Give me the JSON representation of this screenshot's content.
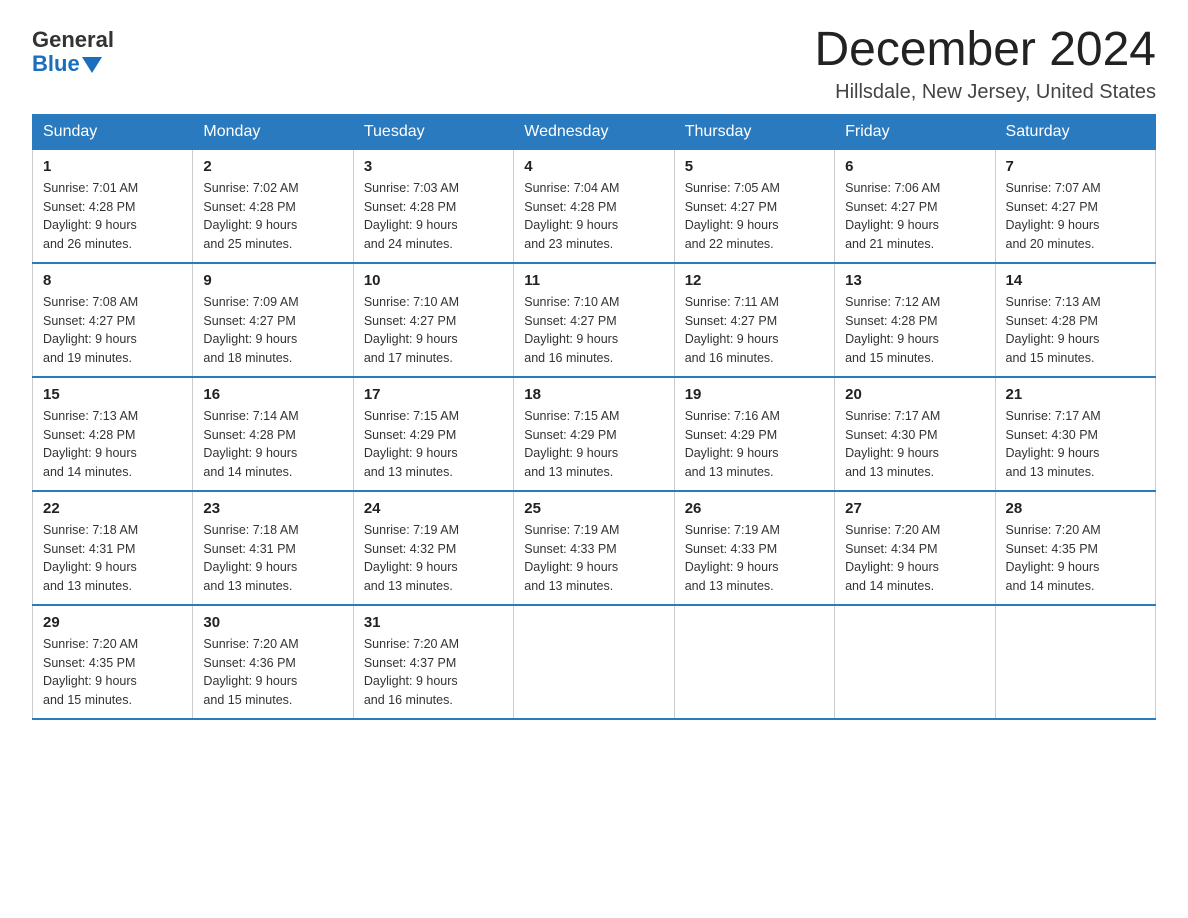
{
  "logo": {
    "general": "General",
    "blue": "Blue"
  },
  "header": {
    "month": "December 2024",
    "location": "Hillsdale, New Jersey, United States"
  },
  "weekdays": [
    "Sunday",
    "Monday",
    "Tuesday",
    "Wednesday",
    "Thursday",
    "Friday",
    "Saturday"
  ],
  "weeks": [
    [
      {
        "day": "1",
        "sunrise": "7:01 AM",
        "sunset": "4:28 PM",
        "daylight": "9 hours and 26 minutes."
      },
      {
        "day": "2",
        "sunrise": "7:02 AM",
        "sunset": "4:28 PM",
        "daylight": "9 hours and 25 minutes."
      },
      {
        "day": "3",
        "sunrise": "7:03 AM",
        "sunset": "4:28 PM",
        "daylight": "9 hours and 24 minutes."
      },
      {
        "day": "4",
        "sunrise": "7:04 AM",
        "sunset": "4:28 PM",
        "daylight": "9 hours and 23 minutes."
      },
      {
        "day": "5",
        "sunrise": "7:05 AM",
        "sunset": "4:27 PM",
        "daylight": "9 hours and 22 minutes."
      },
      {
        "day": "6",
        "sunrise": "7:06 AM",
        "sunset": "4:27 PM",
        "daylight": "9 hours and 21 minutes."
      },
      {
        "day": "7",
        "sunrise": "7:07 AM",
        "sunset": "4:27 PM",
        "daylight": "9 hours and 20 minutes."
      }
    ],
    [
      {
        "day": "8",
        "sunrise": "7:08 AM",
        "sunset": "4:27 PM",
        "daylight": "9 hours and 19 minutes."
      },
      {
        "day": "9",
        "sunrise": "7:09 AM",
        "sunset": "4:27 PM",
        "daylight": "9 hours and 18 minutes."
      },
      {
        "day": "10",
        "sunrise": "7:10 AM",
        "sunset": "4:27 PM",
        "daylight": "9 hours and 17 minutes."
      },
      {
        "day": "11",
        "sunrise": "7:10 AM",
        "sunset": "4:27 PM",
        "daylight": "9 hours and 16 minutes."
      },
      {
        "day": "12",
        "sunrise": "7:11 AM",
        "sunset": "4:27 PM",
        "daylight": "9 hours and 16 minutes."
      },
      {
        "day": "13",
        "sunrise": "7:12 AM",
        "sunset": "4:28 PM",
        "daylight": "9 hours and 15 minutes."
      },
      {
        "day": "14",
        "sunrise": "7:13 AM",
        "sunset": "4:28 PM",
        "daylight": "9 hours and 15 minutes."
      }
    ],
    [
      {
        "day": "15",
        "sunrise": "7:13 AM",
        "sunset": "4:28 PM",
        "daylight": "9 hours and 14 minutes."
      },
      {
        "day": "16",
        "sunrise": "7:14 AM",
        "sunset": "4:28 PM",
        "daylight": "9 hours and 14 minutes."
      },
      {
        "day": "17",
        "sunrise": "7:15 AM",
        "sunset": "4:29 PM",
        "daylight": "9 hours and 13 minutes."
      },
      {
        "day": "18",
        "sunrise": "7:15 AM",
        "sunset": "4:29 PM",
        "daylight": "9 hours and 13 minutes."
      },
      {
        "day": "19",
        "sunrise": "7:16 AM",
        "sunset": "4:29 PM",
        "daylight": "9 hours and 13 minutes."
      },
      {
        "day": "20",
        "sunrise": "7:17 AM",
        "sunset": "4:30 PM",
        "daylight": "9 hours and 13 minutes."
      },
      {
        "day": "21",
        "sunrise": "7:17 AM",
        "sunset": "4:30 PM",
        "daylight": "9 hours and 13 minutes."
      }
    ],
    [
      {
        "day": "22",
        "sunrise": "7:18 AM",
        "sunset": "4:31 PM",
        "daylight": "9 hours and 13 minutes."
      },
      {
        "day": "23",
        "sunrise": "7:18 AM",
        "sunset": "4:31 PM",
        "daylight": "9 hours and 13 minutes."
      },
      {
        "day": "24",
        "sunrise": "7:19 AM",
        "sunset": "4:32 PM",
        "daylight": "9 hours and 13 minutes."
      },
      {
        "day": "25",
        "sunrise": "7:19 AM",
        "sunset": "4:33 PM",
        "daylight": "9 hours and 13 minutes."
      },
      {
        "day": "26",
        "sunrise": "7:19 AM",
        "sunset": "4:33 PM",
        "daylight": "9 hours and 13 minutes."
      },
      {
        "day": "27",
        "sunrise": "7:20 AM",
        "sunset": "4:34 PM",
        "daylight": "9 hours and 14 minutes."
      },
      {
        "day": "28",
        "sunrise": "7:20 AM",
        "sunset": "4:35 PM",
        "daylight": "9 hours and 14 minutes."
      }
    ],
    [
      {
        "day": "29",
        "sunrise": "7:20 AM",
        "sunset": "4:35 PM",
        "daylight": "9 hours and 15 minutes."
      },
      {
        "day": "30",
        "sunrise": "7:20 AM",
        "sunset": "4:36 PM",
        "daylight": "9 hours and 15 minutes."
      },
      {
        "day": "31",
        "sunrise": "7:20 AM",
        "sunset": "4:37 PM",
        "daylight": "9 hours and 16 minutes."
      },
      null,
      null,
      null,
      null
    ]
  ],
  "labels": {
    "sunrise": "Sunrise:",
    "sunset": "Sunset:",
    "daylight": "Daylight:"
  }
}
